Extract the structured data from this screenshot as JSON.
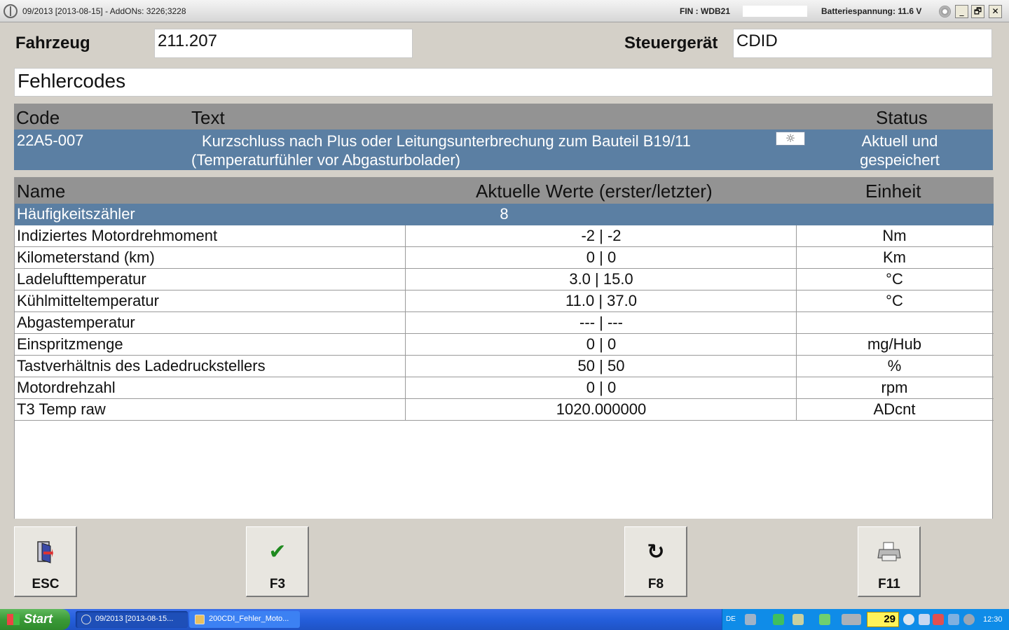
{
  "window": {
    "title": "09/2013 [2013-08-15] - AddONs: 3226;3228",
    "fin": "FIN : WDB21",
    "battery": "Batteriespannung: 11.6 V",
    "minimize": "_",
    "restore": "🗗",
    "close": "✕"
  },
  "vehicle": {
    "fahrzeug_label": "Fahrzeug",
    "fahrzeug_value": "211.207",
    "steuergeraet_label": "Steuergerät",
    "steuergeraet_value": "CDID"
  },
  "section_title": "Fehlercodes",
  "fault_table": {
    "headers": {
      "code": "Code",
      "text": "Text",
      "status": "Status"
    },
    "row": {
      "code": "22A5-007",
      "text_line1": "Kurzschluss nach Plus oder Leitungsunterbrechung zum Bauteil B19/11",
      "text_line2": "(Temperaturfühler vor Abgasturbolader)",
      "status_line1": "Aktuell und",
      "status_line2": "gespeichert",
      "icon": "☼"
    }
  },
  "values_table": {
    "headers": {
      "name": "Name",
      "values": "Aktuelle Werte (erster/letzter)",
      "unit": "Einheit"
    },
    "frequency": {
      "name": "Häufigkeitszähler",
      "value": "8"
    },
    "rows": [
      {
        "name": "Indiziertes Motordrehmoment",
        "value": "-2 | -2",
        "unit": "Nm"
      },
      {
        "name": "Kilometerstand (km)",
        "value": "0 | 0",
        "unit": "Km"
      },
      {
        "name": "Ladelufttemperatur",
        "value": "3.0 | 15.0",
        "unit": "°C"
      },
      {
        "name": "Kühlmitteltemperatur",
        "value": "11.0 | 37.0",
        "unit": "°C"
      },
      {
        "name": "Abgastemperatur",
        "value": "--- | ---",
        "unit": ""
      },
      {
        "name": "Einspritzmenge",
        "value": "0 | 0",
        "unit": "mg/Hub"
      },
      {
        "name": "Tastverhältnis des Ladedruckstellers",
        "value": "50 | 50",
        "unit": "%"
      },
      {
        "name": "Motordrehzahl",
        "value": "0 | 0",
        "unit": "rpm"
      },
      {
        "name": "T3 Temp raw",
        "value": "1020.000000",
        "unit": "ADcnt"
      }
    ]
  },
  "function_keys": [
    {
      "label": "ESC",
      "icon": "exit-door-icon"
    },
    {
      "label": "F3",
      "icon": "checkmark-icon",
      "glyph": "✔"
    },
    {
      "label": "F8",
      "icon": "refresh-icon",
      "glyph": "↻"
    },
    {
      "label": "F11",
      "icon": "printer-icon"
    }
  ],
  "taskbar": {
    "start": "Start",
    "tasks": [
      "09/2013 [2013-08-15...",
      "200CDI_Fehler_Moto..."
    ],
    "lang": "DE",
    "badge": "29",
    "clock": "12:30"
  },
  "colors": {
    "header_gray": "#939393",
    "selected_blue": "#5b7fa3",
    "panel": "#d4d0c8",
    "taskbar_blue": "#245edb"
  }
}
